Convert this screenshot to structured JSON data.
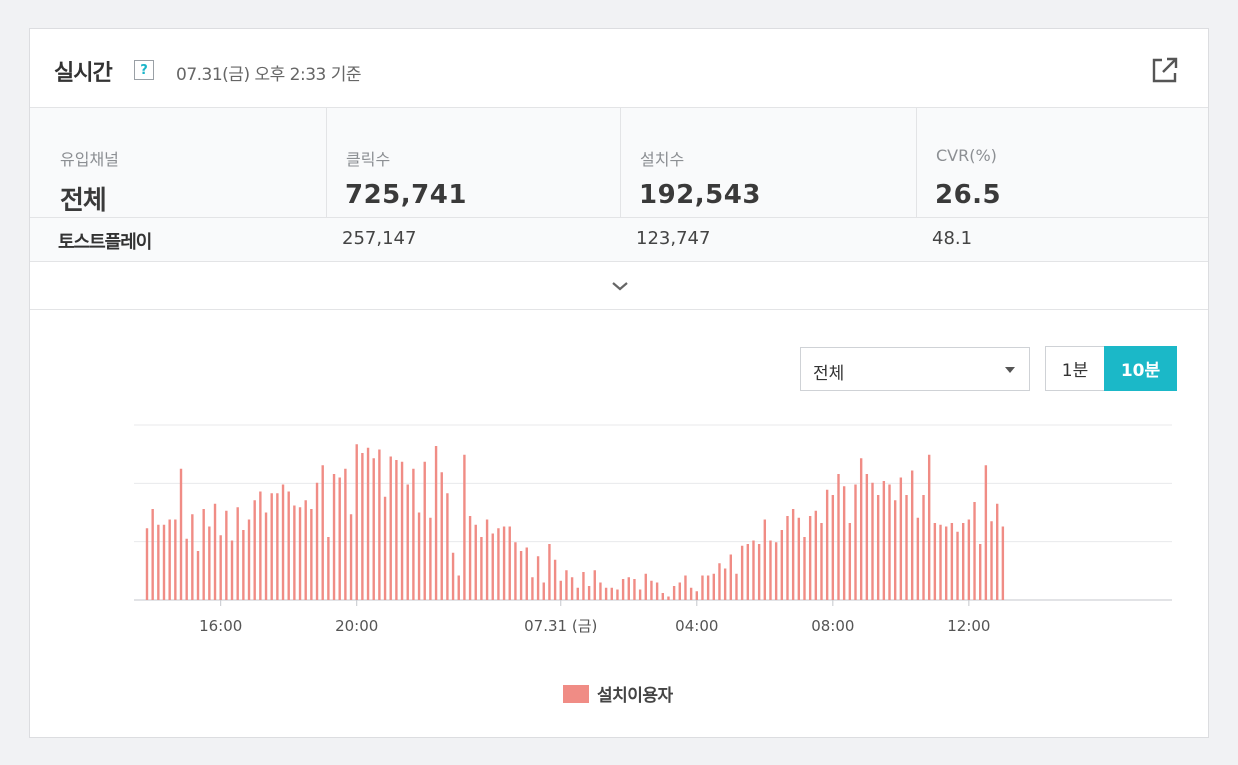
{
  "header": {
    "title": "실시간",
    "help": "?",
    "timestamp": "07.31(금) 오후 2:33 기준"
  },
  "stats": {
    "columns": [
      "유입채널",
      "클릭수",
      "설치수",
      "CVR(%)"
    ],
    "total": [
      "전체",
      "725,741",
      "192,543",
      "26.5"
    ],
    "sub": [
      "토스트플레이",
      "257,147",
      "123,747",
      "48.1"
    ]
  },
  "filter": {
    "selected": "전체",
    "interval_1": "1분",
    "interval_10": "10분",
    "active_interval": "10분"
  },
  "colors": {
    "bar": "#f08c85",
    "accent": "#1bb8c8"
  },
  "chart_data": {
    "type": "bar",
    "xlabel": "",
    "ylabel": "",
    "tick_labels": [
      "16:00",
      "20:00",
      "07.31 (금)",
      "04:00",
      "08:00",
      "12:00"
    ],
    "series": [
      {
        "name": "설치이용자",
        "values": [
          41,
          52,
          43,
          43,
          46,
          46,
          75,
          35,
          49,
          28,
          52,
          42,
          55,
          37,
          51,
          34,
          53,
          40,
          46,
          57,
          62,
          50,
          61,
          61,
          66,
          62,
          54,
          53,
          57,
          52,
          67,
          77,
          36,
          72,
          70,
          75,
          49,
          89,
          84,
          87,
          81,
          86,
          59,
          82,
          80,
          79,
          66,
          75,
          50,
          79,
          47,
          88,
          73,
          61,
          27,
          14,
          83,
          48,
          43,
          36,
          46,
          38,
          41,
          42,
          42,
          33,
          28,
          30,
          13,
          25,
          10,
          32,
          23,
          11,
          17,
          13,
          7,
          16,
          8,
          17,
          10,
          7,
          7,
          6,
          12,
          13,
          12,
          6,
          15,
          11,
          10,
          4,
          2,
          8,
          10,
          14,
          7,
          5,
          14,
          14,
          15,
          21,
          18,
          26,
          15,
          31,
          32,
          34,
          32,
          46,
          34,
          33,
          40,
          48,
          52,
          47,
          36,
          48,
          51,
          44,
          63,
          60,
          72,
          65,
          44,
          66,
          81,
          72,
          67,
          60,
          68,
          66,
          57,
          70,
          60,
          74,
          47,
          60,
          83,
          44,
          43,
          42,
          44,
          39,
          44,
          46,
          56,
          32,
          77,
          45,
          55,
          42
        ]
      }
    ],
    "ylim": [
      0,
      100
    ],
    "grid": true,
    "legend": "bottom"
  }
}
